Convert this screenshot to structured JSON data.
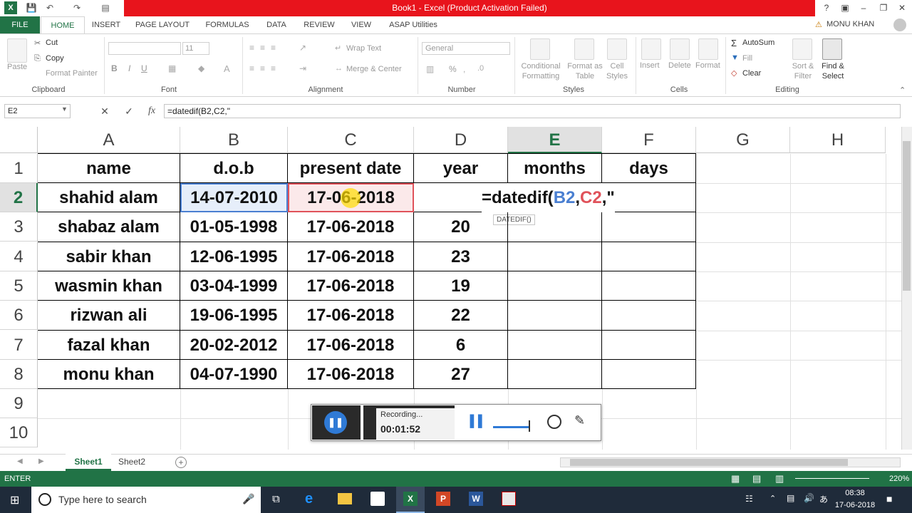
{
  "window": {
    "title": "Book1 - Excel (Product Activation Failed)",
    "user": "MONU KHAN",
    "help": "?",
    "minimize": "–",
    "restore": "❐",
    "close": "✕"
  },
  "ribbon_tabs": [
    "FILE",
    "HOME",
    "INSERT",
    "PAGE LAYOUT",
    "FORMULAS",
    "DATA",
    "REVIEW",
    "VIEW",
    "ASAP Utilities"
  ],
  "ribbon": {
    "clipboard": {
      "paste": "Paste",
      "cut": "Cut",
      "copy": "Copy",
      "format_painter": "Format Painter",
      "group": "Clipboard"
    },
    "font": {
      "size": "11",
      "group": "Font",
      "bold": "B",
      "italic": "I",
      "underline": "U"
    },
    "alignment": {
      "wrap": "Wrap Text",
      "merge": "Merge & Center",
      "group": "Alignment"
    },
    "number": {
      "format": "General",
      "percent": "%",
      "group": "Number"
    },
    "styles": {
      "conditional": "Conditional Formatting",
      "format_table": "Format as Table",
      "cell_styles": "Cell Styles",
      "group": "Styles"
    },
    "cells": {
      "insert": "Insert",
      "delete": "Delete",
      "format": "Format",
      "group": "Cells"
    },
    "editing": {
      "autosum": "AutoSum",
      "fill": "Fill",
      "clear": "Clear",
      "sort": "Sort & Filter",
      "find": "Find & Select",
      "group": "Editing"
    }
  },
  "formula_bar": {
    "name_box": "E2",
    "formula": "=datedif(B2,C2,\"",
    "cancel": "✕",
    "enter": "✓",
    "fx": "fx"
  },
  "columns": [
    "A",
    "B",
    "C",
    "D",
    "E",
    "F",
    "G",
    "H"
  ],
  "rows": [
    "1",
    "2",
    "3",
    "4",
    "5",
    "6",
    "7",
    "8",
    "9",
    "10"
  ],
  "headers": {
    "name": "name",
    "dob": "d.o.b",
    "present": "present date",
    "year": "year",
    "months": "months",
    "days": "days"
  },
  "table": [
    {
      "name": "shahid alam",
      "dob": "14-07-2010",
      "present": "17-06-2018",
      "year": ""
    },
    {
      "name": "shabaz alam",
      "dob": "01-05-1998",
      "present": "17-06-2018",
      "year": "20"
    },
    {
      "name": "sabir khan",
      "dob": "12-06-1995",
      "present": "17-06-2018",
      "year": "23"
    },
    {
      "name": "wasmin khan",
      "dob": "03-04-1999",
      "present": "17-06-2018",
      "year": "19"
    },
    {
      "name": "rizwan ali",
      "dob": "19-06-1995",
      "present": "17-06-2018",
      "year": "22"
    },
    {
      "name": "fazal khan",
      "dob": "20-02-2012",
      "present": "17-06-2018",
      "year": "6"
    },
    {
      "name": "monu khan",
      "dob": "04-07-1990",
      "present": "17-06-2018",
      "year": "27"
    }
  ],
  "edit_cell": {
    "prefix": "=datedif(",
    "ref1": "B2",
    "comma1": ",",
    "ref2": "C2",
    "suffix": ",\"",
    "tooltip": "DATEDIF()"
  },
  "recorder": {
    "status": "Recording...",
    "time": "00:01:52"
  },
  "sheets": [
    "Sheet1",
    "Sheet2"
  ],
  "status": {
    "mode": "ENTER",
    "zoom": "220%"
  },
  "taskbar": {
    "search": "Type here to search",
    "time": "08:38",
    "date": "17-06-2018"
  },
  "colors": {
    "excel_green": "#217346",
    "title_red": "#e8141c",
    "ref_blue": "#4a7fd1",
    "ref_red": "#e0525a"
  }
}
